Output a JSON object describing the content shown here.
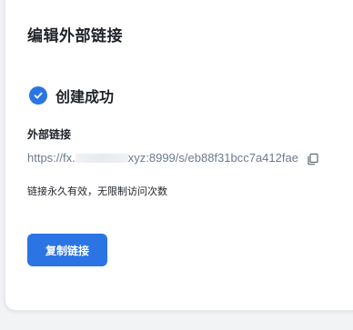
{
  "dialog": {
    "title": "编辑外部链接",
    "success_text": "创建成功",
    "section_label": "外部链接",
    "link_prefix": "https://fx.",
    "link_suffix": "xyz:8999/s/eb88f31bcc7a412fae",
    "note": "链接永久有效，无限制访问次数",
    "copy_button_label": "复制链接"
  },
  "colors": {
    "accent": "#2b74e3",
    "link": "#6b7a90",
    "text": "#1f2329"
  },
  "icons": {
    "success": "check-circle-icon",
    "copy": "copy-icon"
  }
}
